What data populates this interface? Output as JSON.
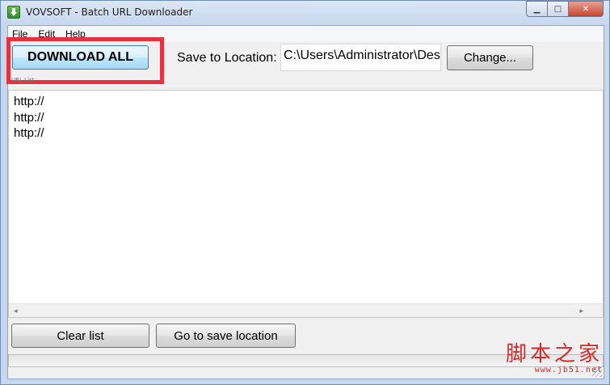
{
  "window": {
    "title": "VOVSOFT - Batch URL Downloader",
    "minimize_glyph": "▁",
    "maximize_glyph": "□",
    "close_glyph": "✕"
  },
  "menu": {
    "file": "File",
    "edit": "Edit",
    "help": "Help"
  },
  "toolbar": {
    "download_all_label": "DOWNLOAD ALL",
    "save_location_label": "Save to Location:",
    "save_location_value": "C:\\Users\\Administrator\\Des",
    "change_label": "Change..."
  },
  "url_list": {
    "label": "URL List",
    "lines": [
      "http://",
      "http://",
      "http://"
    ],
    "scroll_left": "◂",
    "scroll_right": "▸"
  },
  "actions": {
    "clear_list_label": "Clear list",
    "go_to_save_location_label": "Go to save location"
  },
  "progress": {
    "value": 0
  },
  "watermark": {
    "name": "脚本之家",
    "url": "www.jb51.net"
  },
  "colors": {
    "highlight": "#e8313e",
    "watermark": "#d22a2a"
  }
}
